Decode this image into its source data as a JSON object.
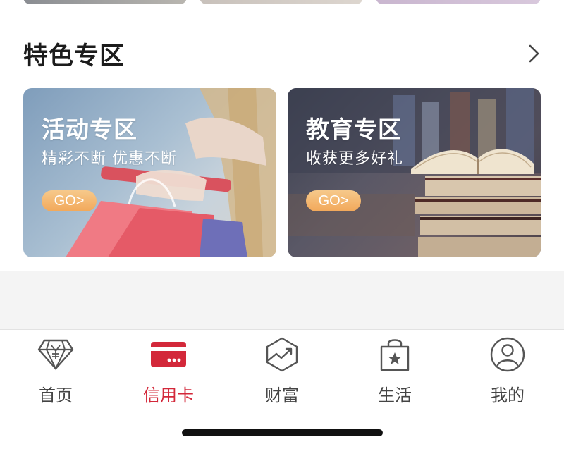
{
  "section": {
    "title": "特色专区"
  },
  "cards": [
    {
      "title": "活动专区",
      "subtitle": "精彩不断 优惠不断",
      "button": "GO>"
    },
    {
      "title": "教育专区",
      "subtitle": "收获更多好礼",
      "button": "GO>"
    }
  ],
  "tabbar": {
    "items": [
      {
        "label": "首页",
        "icon": "diamond-icon",
        "active": false
      },
      {
        "label": "信用卡",
        "icon": "credit-card-icon",
        "active": true
      },
      {
        "label": "财富",
        "icon": "trend-chart-icon",
        "active": false
      },
      {
        "label": "生活",
        "icon": "shopping-bag-icon",
        "active": false
      },
      {
        "label": "我的",
        "icon": "user-icon",
        "active": false
      }
    ]
  },
  "colors": {
    "accent": "#d3283a",
    "tab_inactive": "#444444",
    "button": "#f2a85a"
  }
}
